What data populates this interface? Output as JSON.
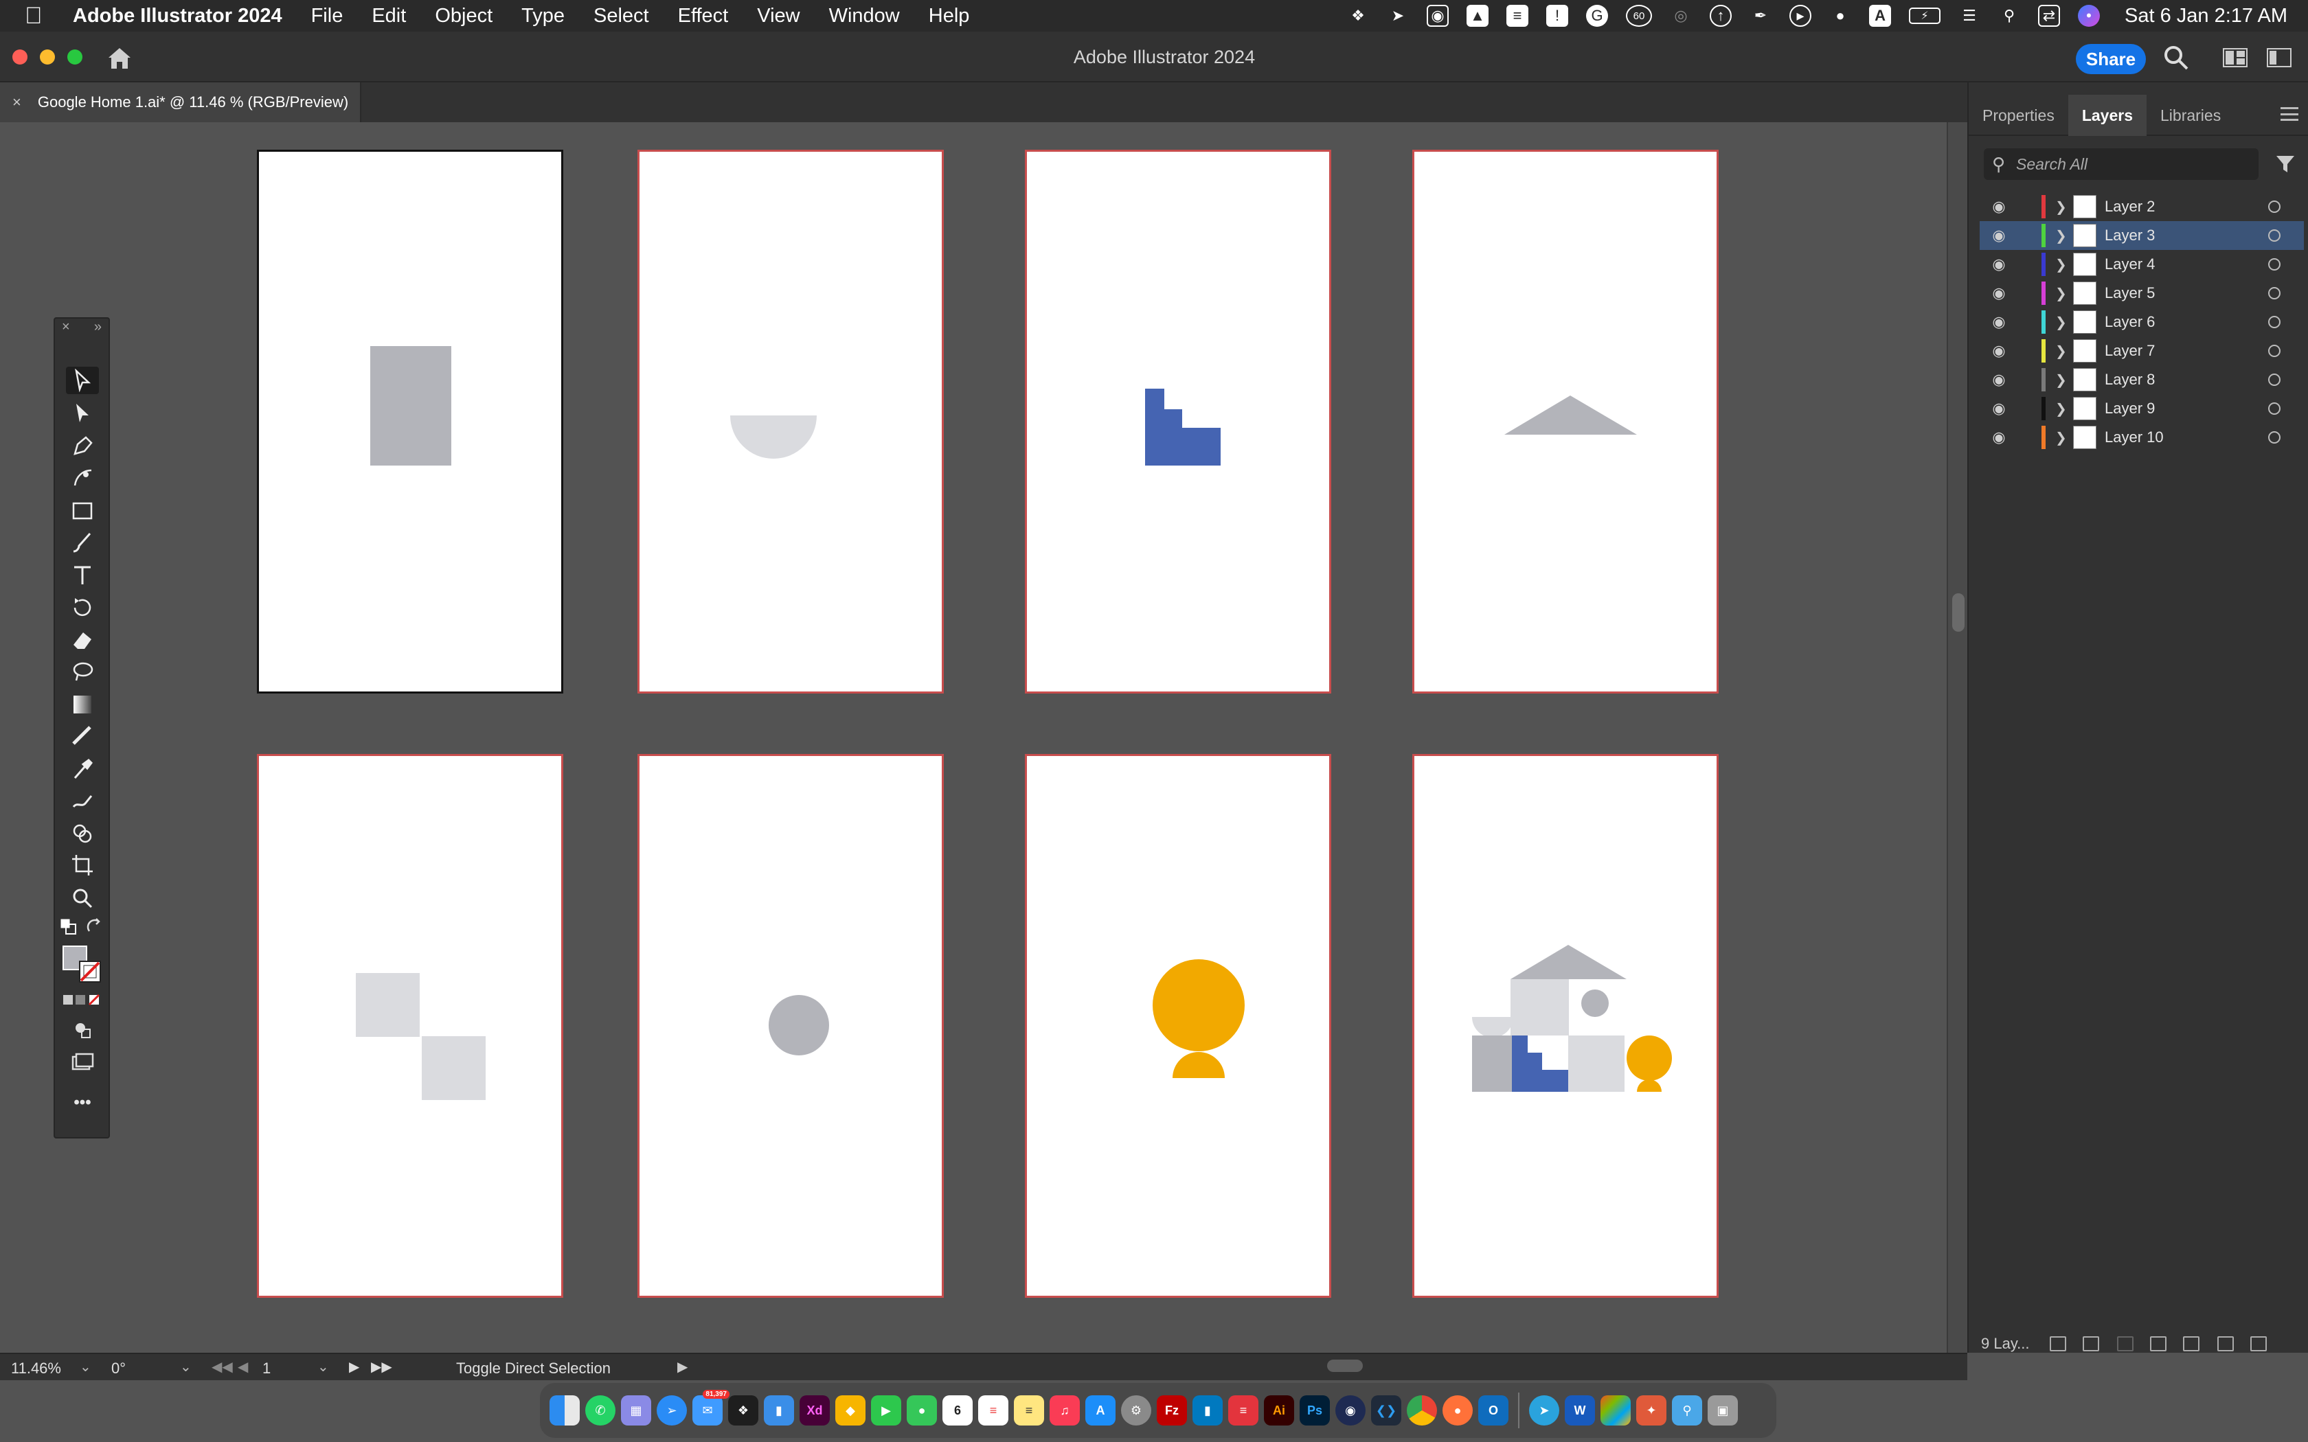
{
  "menubar": {
    "app_name": "Adobe Illustrator 2024",
    "items": [
      "File",
      "Edit",
      "Object",
      "Type",
      "Select",
      "Effect",
      "View",
      "Window",
      "Help"
    ],
    "status_badge": "60",
    "input_source": "A",
    "clock": "Sat 6 Jan  2:17 AM"
  },
  "window": {
    "title": "Adobe Illustrator 2024",
    "share_label": "Share"
  },
  "document_tab": {
    "close_glyph": "×",
    "label": "Google Home 1.ai* @ 11.46 % (RGB/Preview)"
  },
  "artboards": [
    {
      "id": "ab1",
      "shape": "rectangle",
      "color": "#b3b4ba",
      "active": true
    },
    {
      "id": "ab2",
      "shape": "semicircle",
      "color": "#dadbdf"
    },
    {
      "id": "ab3",
      "shape": "stairs",
      "color": "#4564b2"
    },
    {
      "id": "ab4",
      "shape": "triangle",
      "color": "#b3b4ba"
    },
    {
      "id": "ab5",
      "shape": "checker-squares",
      "color": "#dadbdf"
    },
    {
      "id": "ab6",
      "shape": "circle",
      "color": "#b3b4ba"
    },
    {
      "id": "ab7",
      "shape": "circle-on-semicircle",
      "color": "#f2a900"
    },
    {
      "id": "ab8",
      "shape": "composed-house",
      "colors": [
        "#b3b4ba",
        "#dadbdf",
        "#4564b2",
        "#f2a900"
      ]
    }
  ],
  "panel": {
    "tabs": [
      "Properties",
      "Layers",
      "Libraries"
    ],
    "active_tab": "Layers",
    "search_placeholder": "Search All",
    "layers": [
      {
        "name": "Layer 2",
        "color": "#e0393e"
      },
      {
        "name": "Layer 3",
        "color": "#4fd23f",
        "selected": true
      },
      {
        "name": "Layer 4",
        "color": "#3a3ad0"
      },
      {
        "name": "Layer 5",
        "color": "#d63fd6"
      },
      {
        "name": "Layer 6",
        "color": "#3fd6d6"
      },
      {
        "name": "Layer 7",
        "color": "#e6e63f"
      },
      {
        "name": "Layer 8",
        "color": "#7a7a7a"
      },
      {
        "name": "Layer 9",
        "color": "#111111"
      },
      {
        "name": "Layer 10",
        "color": "#f07a28"
      }
    ],
    "footer_count": "9 Lay..."
  },
  "statusbar": {
    "zoom": "11.46%",
    "rotation": "0°",
    "artboard_number": "1",
    "status_text": "Toggle Direct Selection"
  },
  "dock": {
    "mail_badge": "81,397"
  }
}
